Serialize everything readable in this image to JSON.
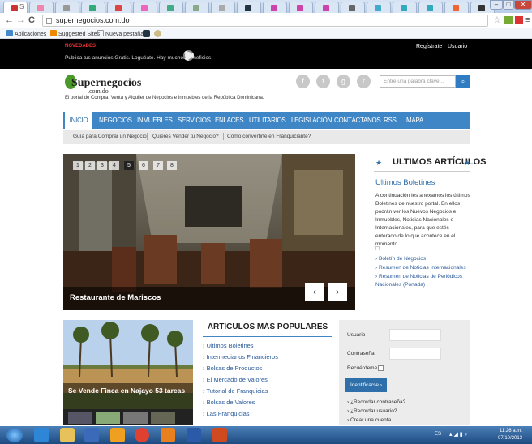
{
  "browser": {
    "url": "supernegocios.com.do",
    "active_tab_label": "S",
    "bookmarks": [
      "Aplicaciones",
      "Suggested Sites",
      "Nueva pestaña"
    ]
  },
  "topbar": {
    "badge": "NOVEDADES",
    "ticker": "Publica tus anuncios Gratis. Loguéate. Hay muchos beneficios.",
    "register": "Regístrate",
    "user": "Usuario"
  },
  "header": {
    "logo_main": "Supernegocios",
    "logo_sub": ".com.do",
    "tagline": "El portal de Compra, Venta y Alquiler de Negocios e Inmuebles de la República Dominicana.",
    "search_placeholder": "Entre una palabra clave..."
  },
  "nav": [
    "INICIO",
    "NEGOCIOS",
    "INMUEBLES",
    "SERVICIOS",
    "ENLACES",
    "UTILITARIOS",
    "LEGISLACIÓN",
    "CONTÁCTANOS",
    "RSS",
    "MAPA"
  ],
  "subnav": [
    "Guía para Comprar un Negocio",
    "Quieres Vender tu Negocio?",
    "Cómo convertirte en Franquiciante?"
  ],
  "slider": {
    "pages": [
      "1",
      "2",
      "3",
      "4",
      "5",
      "6",
      "7",
      "8"
    ],
    "active_page": "5",
    "caption": "Restaurante de Mariscos"
  },
  "sidebar": {
    "title": "ULTIMOS ARTÍCULOS",
    "subtitle": "Ultimos Boletines",
    "paragraph": "A continuación les anexamos los últimos Boletines de nuestro portal. En ellos podrán ver los Nuevos Negocios e Inmuebles, Noticias Nacionales e Internacionales, para que estés enterado de lo que acontece en el momento.",
    "links": [
      "Boletín de Negocios",
      "Resumen de Noticias Internacionales",
      "Resumen de Noticias de Periódicos Nacionales (Portada)"
    ]
  },
  "popular": {
    "title": "ARTÍCULOS MÁS POPULARES",
    "items": [
      "Ultimos Boletines",
      "Intermediarios Financieros",
      "Bolsas de Productos",
      "El Mercado de Valores",
      "Tutorial de Franquicias",
      "Bolsas de Valores",
      "Las Franquicias"
    ]
  },
  "feature": {
    "caption": "Se Vende Finca en Najayo 53 tareas"
  },
  "login": {
    "user_label": "Usuario",
    "password_label": "Contraseña",
    "remember_label": "Recuérdeme",
    "button": "Identificarse",
    "links": [
      "¿Recordar contraseña?",
      "¿Recordar usuario?",
      "Crear una cuenta"
    ]
  },
  "taskbar": {
    "lang": "ES",
    "time": "11:26 a.m.",
    "date": "07/10/2013"
  }
}
